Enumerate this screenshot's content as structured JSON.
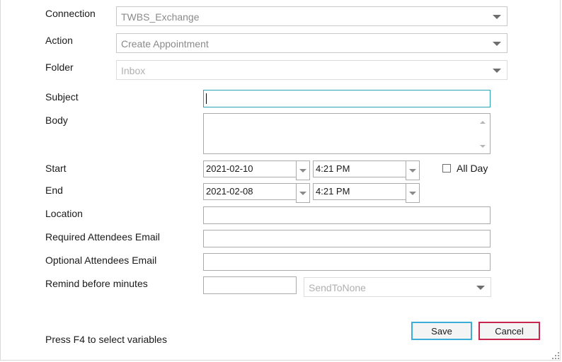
{
  "form": {
    "connection": {
      "label": "Connection",
      "value": "TWBS_Exchange"
    },
    "action": {
      "label": "Action",
      "value": "Create Appointment"
    },
    "folder": {
      "label": "Folder",
      "value": "Inbox"
    },
    "subject": {
      "label": "Subject",
      "value": ""
    },
    "body": {
      "label": "Body",
      "value": ""
    },
    "start": {
      "label": "Start",
      "date": "2021-02-10",
      "time": "4:21 PM"
    },
    "end": {
      "label": "End",
      "date": "2021-02-08",
      "time": "4:21 PM"
    },
    "all_day": {
      "label": "All Day",
      "checked": false
    },
    "location": {
      "label": "Location",
      "value": ""
    },
    "required_attendees": {
      "label": "Required Attendees Email",
      "value": ""
    },
    "optional_attendees": {
      "label": "Optional Attendees Email",
      "value": ""
    },
    "remind": {
      "label": "Remind before minutes",
      "value": "",
      "send_option": "SendToNone"
    }
  },
  "footer": {
    "hint": "Press F4 to select variables",
    "save_label": "Save",
    "cancel_label": "Cancel"
  },
  "colors": {
    "focus_border": "#2aa3b3",
    "save_border": "#3aaed8",
    "cancel_border": "#c8264e"
  },
  "icons": {
    "dropdown": "chevron-down-icon",
    "resize": "resize-grip-icon"
  }
}
